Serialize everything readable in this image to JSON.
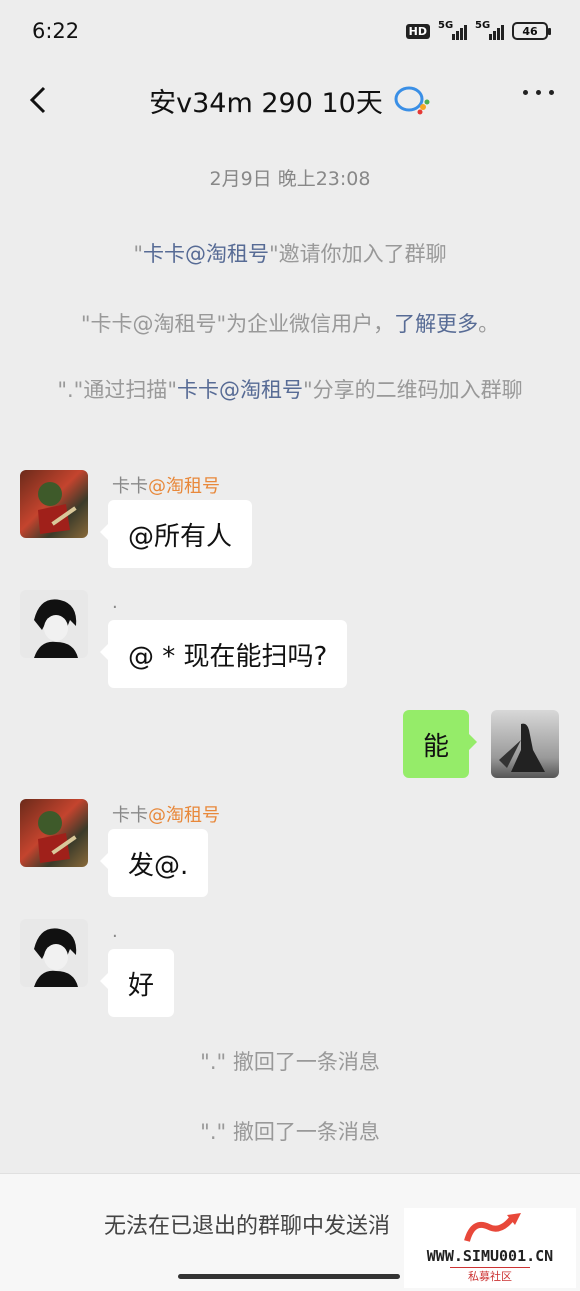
{
  "status_bar": {
    "time": "6:22",
    "hd_label": "HD",
    "net1": "5G",
    "net2": "5G",
    "battery": "46"
  },
  "header": {
    "title": "安v34m 290 10天"
  },
  "chat": {
    "timestamp": "2月9日 晚上23:08",
    "sys1": {
      "q1": "\"",
      "name": "卡卡@淘租号",
      "q2": "\"",
      "text": "邀请你加入了群聊"
    },
    "sys2": {
      "text": "\"卡卡@淘租号\"为企业微信用户，",
      "link": "了解更多",
      "end": "。"
    },
    "sys3": {
      "pre": "\".\"通过扫描\"",
      "name": "卡卡@淘租号",
      "post": "\"分享的二维码加入群聊"
    },
    "messages": [
      {
        "sender": "卡卡",
        "sender_suffix": "@淘租号",
        "text": "@所有人"
      },
      {
        "sender": ".",
        "text": "@ *  现在能扫吗?"
      },
      {
        "self": true,
        "text": "能"
      },
      {
        "sender": "卡卡",
        "sender_suffix": "@淘租号",
        "text": "发@."
      },
      {
        "sender": ".",
        "text": "好"
      }
    ],
    "recall1": "\".\" 撤回了一条消息",
    "recall2": "\".\" 撤回了一条消息"
  },
  "bottom": {
    "notice": "无法在已退出的群聊中发送消"
  },
  "watermark": {
    "url": "WWW.SIMU001.CN",
    "sub": "私募社区"
  },
  "colors": {
    "link": "#576b95",
    "highlight": "#e8883a",
    "self_bubble": "#95ec69",
    "background": "#ededed"
  },
  "icons": [
    "back-arrow-icon",
    "wecom-icon",
    "more-dots-icon"
  ]
}
